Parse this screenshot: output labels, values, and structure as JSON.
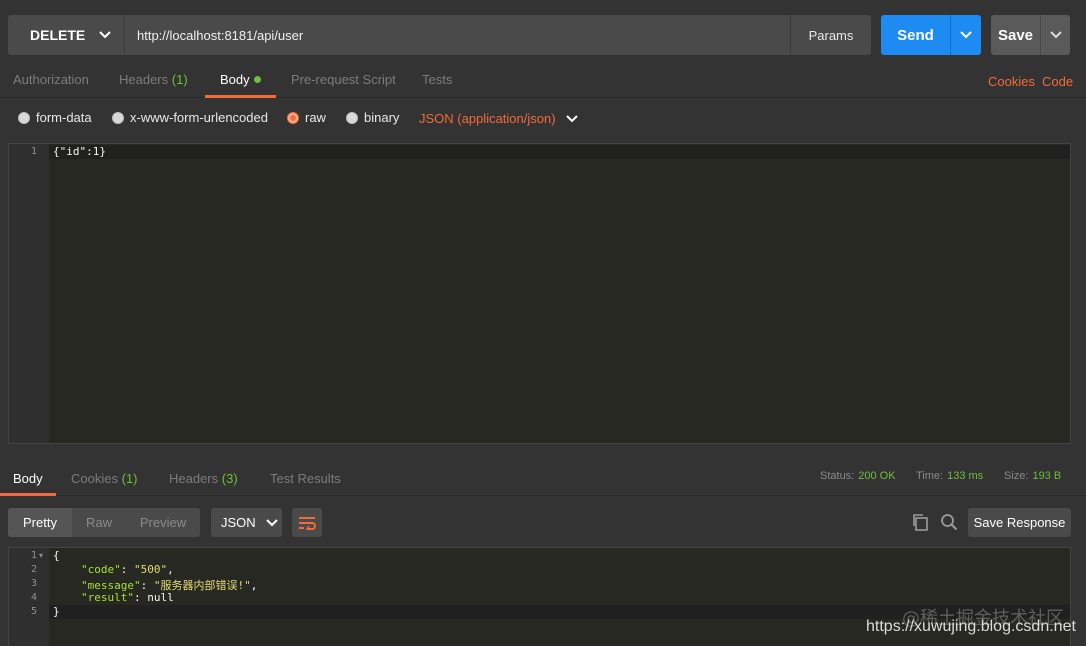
{
  "request": {
    "method": "DELETE",
    "url": "http://localhost:8181/api/user",
    "params_label": "Params",
    "send_label": "Send",
    "save_label": "Save"
  },
  "request_tabs": [
    {
      "label": "Authorization",
      "count": "",
      "active": false
    },
    {
      "label": "Headers",
      "count": "(1)",
      "active": false
    },
    {
      "label": "Body",
      "count": "",
      "active": true
    },
    {
      "label": "Pre-request Script",
      "count": "",
      "active": false
    },
    {
      "label": "Tests",
      "count": "",
      "active": false
    }
  ],
  "request_links": {
    "cookies": "Cookies",
    "code": "Code"
  },
  "body_types": [
    {
      "label": "form-data",
      "selected": false
    },
    {
      "label": "x-www-form-urlencoded",
      "selected": false
    },
    {
      "label": "raw",
      "selected": true
    },
    {
      "label": "binary",
      "selected": false
    }
  ],
  "content_type": "JSON (application/json)",
  "request_body": {
    "lines": [
      "1"
    ],
    "code": "{\"id\":1}"
  },
  "response_tabs": [
    {
      "label": "Body",
      "count": "",
      "active": true
    },
    {
      "label": "Cookies",
      "count": "(1)",
      "active": false
    },
    {
      "label": "Headers",
      "count": "(3)",
      "active": false
    },
    {
      "label": "Test Results",
      "count": "",
      "active": false
    }
  ],
  "response_status": {
    "status_label": "Status:",
    "status_value": "200 OK",
    "time_label": "Time:",
    "time_value": "133 ms",
    "size_label": "Size:",
    "size_value": "193 B"
  },
  "response_view": {
    "modes": [
      "Pretty",
      "Raw",
      "Preview"
    ],
    "format": "JSON",
    "save_response_label": "Save Response"
  },
  "response_body": {
    "line_numbers": [
      "1",
      "2",
      "3",
      "4",
      "5"
    ],
    "code_key": "\"code\"",
    "code_val": "\"500\"",
    "message_key": "\"message\"",
    "message_val": "\"服务器内部错误!\"",
    "result_key": "\"result\"",
    "result_val": "null"
  },
  "watermark": {
    "line1": "@稀土掘金技术社区",
    "line2": "https://xuwujing.blog.csdn.net"
  },
  "colors": {
    "accent_orange": "#f26b3a",
    "send_blue": "#1d8bf1",
    "status_green": "#6fbf3b"
  }
}
